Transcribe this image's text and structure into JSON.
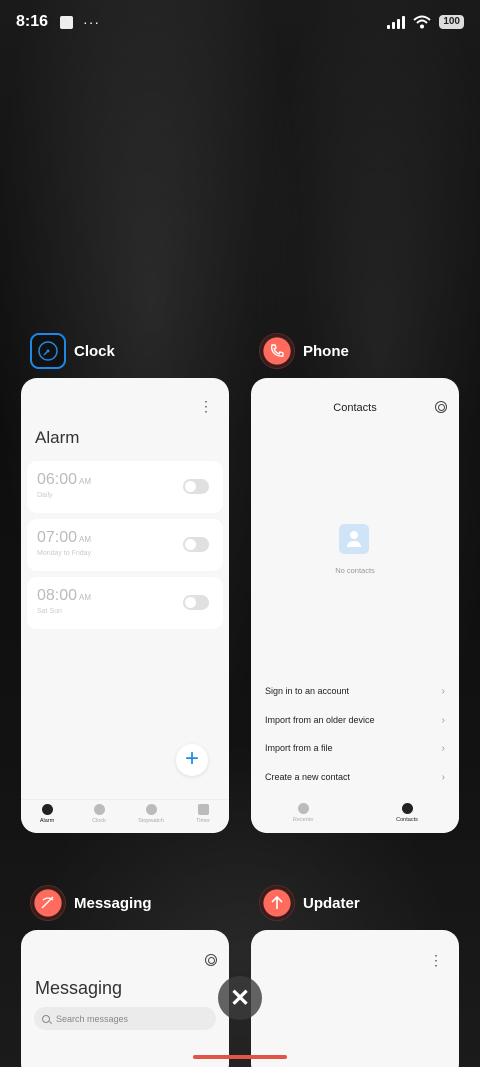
{
  "status_bar": {
    "time": "8:16",
    "notif_dots": "···",
    "battery": "100"
  },
  "apps": [
    {
      "name": "Clock",
      "icon": "clock-icon",
      "card": {
        "title": "Alarm",
        "alarms": [
          {
            "time": "06:00",
            "ampm": "AM",
            "repeat": "Daily"
          },
          {
            "time": "07:00",
            "ampm": "AM",
            "repeat": "Monday to Friday"
          },
          {
            "time": "08:00",
            "ampm": "AM",
            "repeat": "Sat Sun"
          }
        ],
        "fab": "+",
        "nav": [
          "Alarm",
          "Clock",
          "Stopwatch",
          "Timer"
        ]
      }
    },
    {
      "name": "Phone",
      "icon": "phone-icon",
      "card": {
        "title": "Contacts",
        "empty_text": "No contacts",
        "actions": [
          "Sign in to an account",
          "Import from an older device",
          "Import from a file",
          "Create a new contact"
        ],
        "nav": [
          "Recents",
          "Contacts"
        ]
      }
    },
    {
      "name": "Messaging",
      "icon": "messaging-icon",
      "card": {
        "title": "Messaging",
        "search_placeholder": "Search messages"
      }
    },
    {
      "name": "Updater",
      "icon": "updater-icon",
      "card": {}
    }
  ],
  "close_all": "✕",
  "colors": {
    "accent_blue": "#1e88e5",
    "app_red": "#ff6b5c",
    "home_bar": "#e05548"
  }
}
